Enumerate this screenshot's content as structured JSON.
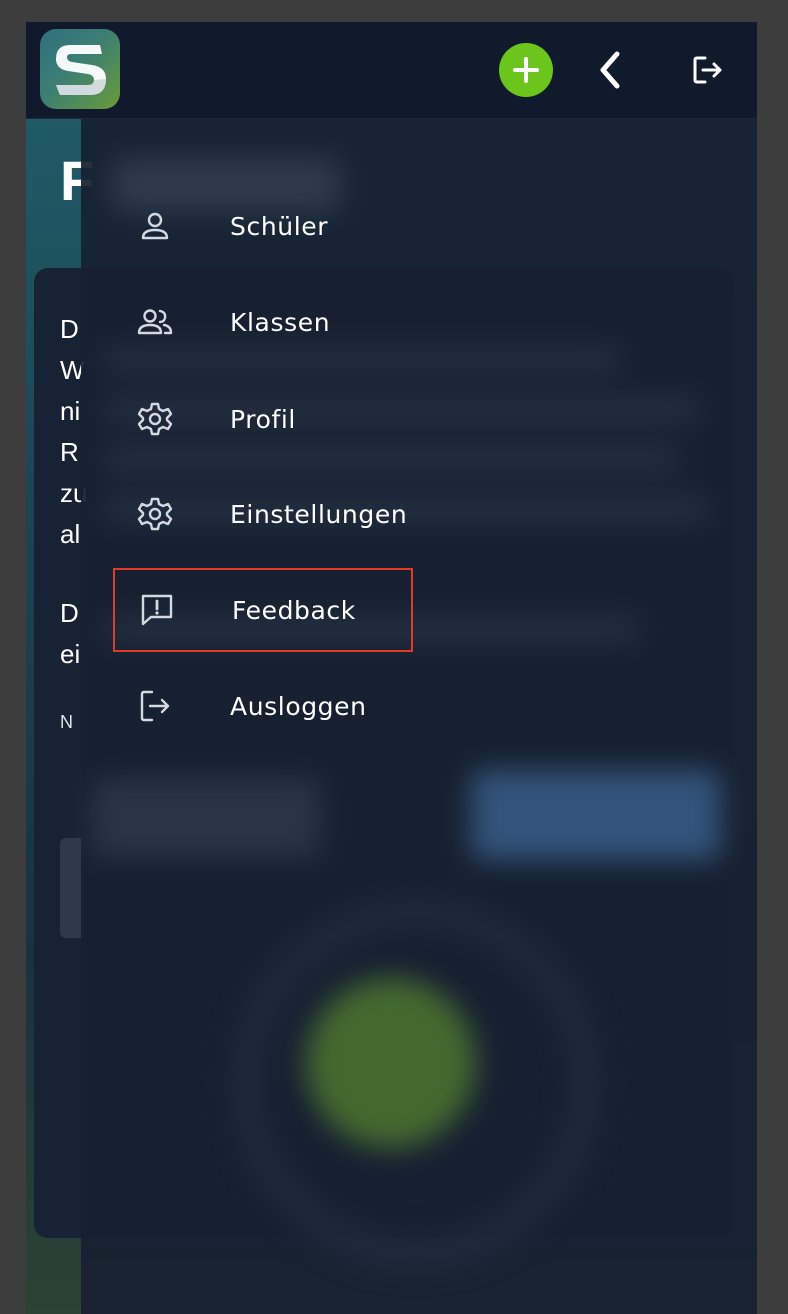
{
  "background": {
    "title": "F",
    "lines": [
      "D",
      "W",
      "ni",
      "R",
      "zu",
      "al",
      "D",
      "ei"
    ],
    "small": "N"
  },
  "menu": {
    "items": [
      {
        "label": "Schüler",
        "icon": "person-icon"
      },
      {
        "label": "Klassen",
        "icon": "people-icon"
      },
      {
        "label": "Profil",
        "icon": "gear-icon"
      },
      {
        "label": "Einstellungen",
        "icon": "gear-icon"
      },
      {
        "label": "Feedback",
        "icon": "feedback-icon"
      },
      {
        "label": "Ausloggen",
        "icon": "logout-icon"
      }
    ]
  },
  "colors": {
    "accent_green": "#6cc51a",
    "highlight_border": "#e13a2a",
    "topbar": "#111a2c",
    "drawer": "#172031"
  }
}
